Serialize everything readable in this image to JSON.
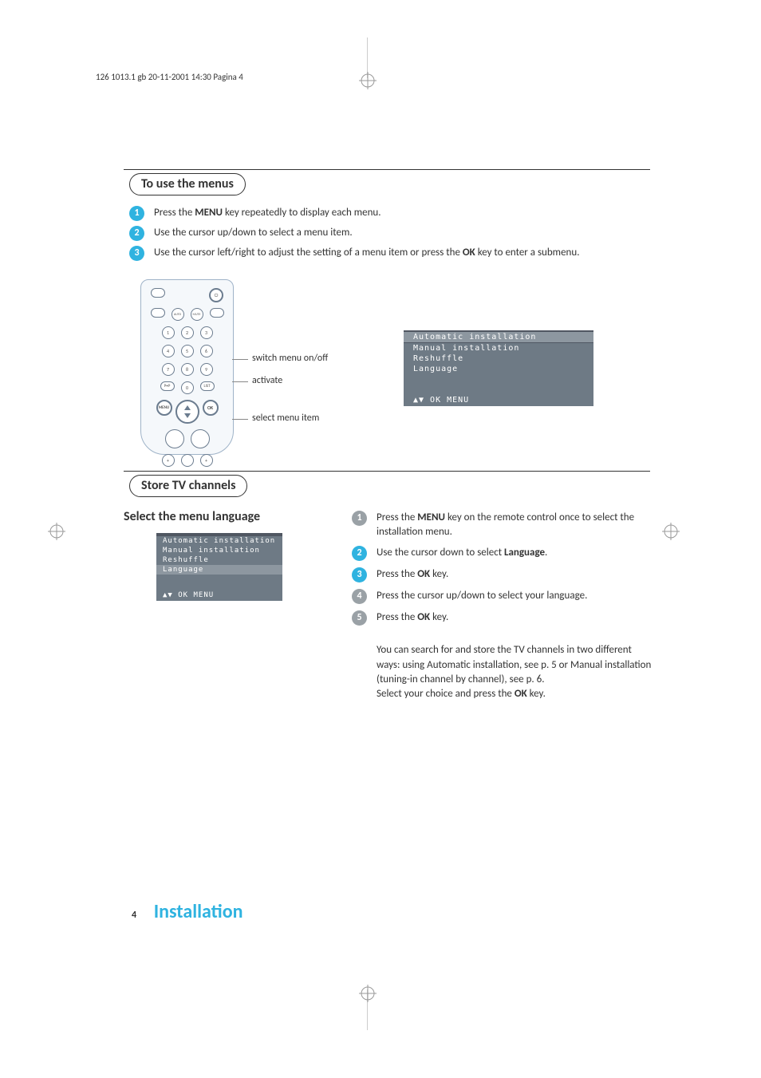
{
  "print_header": "126 1013.1 gb  20-11-2001  14:30  Pagina 4",
  "section1": {
    "title": "To use the menus"
  },
  "steps1": [
    {
      "pre": "Press the ",
      "bold": "MENU",
      "post": " key repeatedly to display each menu."
    },
    {
      "pre": "Use the cursor up/down to select a menu item.",
      "bold": "",
      "post": ""
    },
    {
      "pre": "Use the cursor left/right to adjust the setting of a menu item or press the ",
      "bold": "OK",
      "post": " key to enter a submenu."
    }
  ],
  "remote": {
    "labels": {
      "switch": "switch menu on/off",
      "activate": "activate",
      "select": "select menu item"
    },
    "keys": {
      "auto": "AUTO",
      "mute": "MUTE",
      "pnp": "P•P",
      "list": "LIST",
      "menu": "MENU",
      "ok": "OK",
      "pwr": "⏻"
    },
    "nums": [
      "1",
      "2",
      "3",
      "4",
      "5",
      "6",
      "7",
      "8",
      "9"
    ]
  },
  "osd1": {
    "lines": [
      "Automatic installation",
      "Manual installation",
      "Reshuffle",
      "Language"
    ],
    "selected_index": 0,
    "footer": "▲▼ OK MENU"
  },
  "section2": {
    "title": "Store TV channels"
  },
  "sub_heading": "Select the menu language",
  "osd2": {
    "lines": [
      "Automatic installation",
      "Manual installation",
      "Reshuffle",
      "Language"
    ],
    "selected_index": 3,
    "footer": "▲▼ OK MENU"
  },
  "steps2": [
    {
      "pre": "Press the ",
      "bold": "MENU",
      "post": " key on the remote control once to select the installation menu.",
      "grey": true
    },
    {
      "pre": "Use the cursor down to select ",
      "bold": "Language",
      "post": ".",
      "grey": false
    },
    {
      "pre": "Press the ",
      "bold": "OK",
      "post": " key.",
      "grey": false
    },
    {
      "pre": "Press the cursor up/down to select your language.",
      "bold": "",
      "post": "",
      "grey": true
    },
    {
      "pre": "Press the ",
      "bold": "OK",
      "post": " key.",
      "grey": true
    }
  ],
  "post_text": {
    "p1a": "You can search for and store the TV channels in two different ways: using Automatic installation, see p. 5 or Manual installation (tuning-in channel by channel), see p. 6.",
    "p2a": "Select your choice and press the ",
    "p2b": "OK",
    "p2c": " key."
  },
  "footer": {
    "page": "4",
    "chapter": "Installation"
  }
}
